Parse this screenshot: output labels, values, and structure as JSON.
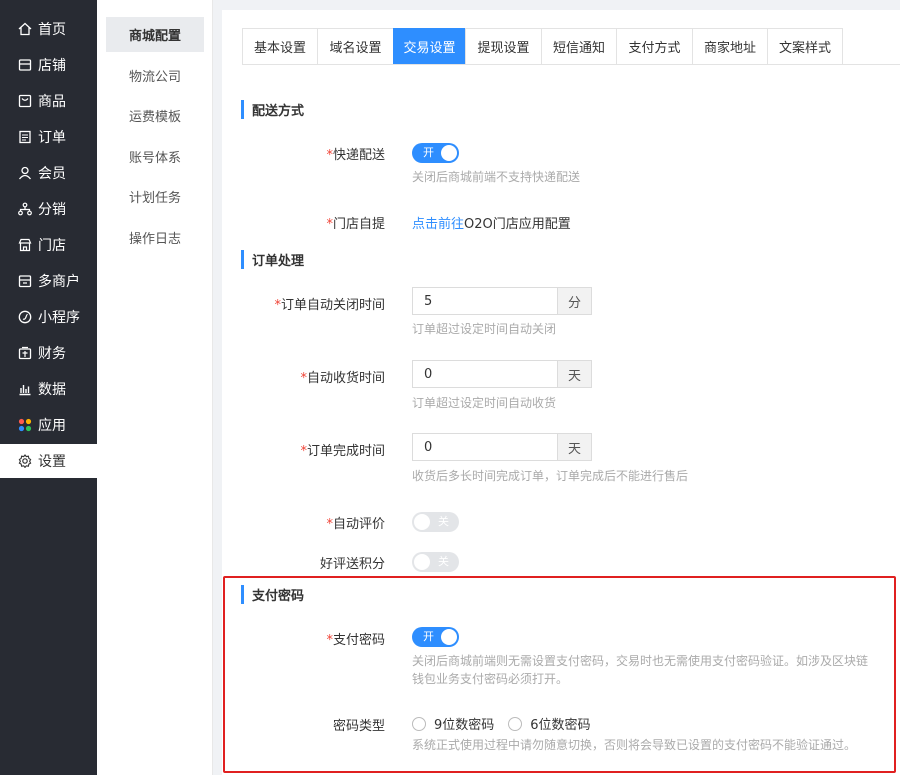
{
  "sidebar": {
    "items": [
      {
        "label": "首页",
        "icon": "home-icon"
      },
      {
        "label": "店铺",
        "icon": "store-icon"
      },
      {
        "label": "商品",
        "icon": "goods-icon"
      },
      {
        "label": "订单",
        "icon": "order-icon"
      },
      {
        "label": "会员",
        "icon": "member-icon"
      },
      {
        "label": "分销",
        "icon": "distribution-icon"
      },
      {
        "label": "门店",
        "icon": "shop-icon"
      },
      {
        "label": "多商户",
        "icon": "multi-merchant-icon"
      },
      {
        "label": "小程序",
        "icon": "mini-program-icon"
      },
      {
        "label": "财务",
        "icon": "finance-icon"
      },
      {
        "label": "数据",
        "icon": "data-icon"
      },
      {
        "label": "应用",
        "icon": "apps-icon"
      },
      {
        "label": "设置",
        "icon": "gear-icon"
      }
    ],
    "active_index": 12
  },
  "subsidebar": {
    "items": [
      "商城配置",
      "物流公司",
      "运费模板",
      "账号体系",
      "计划任务",
      "操作日志"
    ],
    "active_index": 0
  },
  "tabs": {
    "items": [
      "基本设置",
      "域名设置",
      "交易设置",
      "提现设置",
      "短信通知",
      "支付方式",
      "商家地址",
      "文案样式"
    ],
    "active_index": 2
  },
  "delivery": {
    "title": "配送方式",
    "express_label": "快递配送",
    "express_switch": "开",
    "express_help": "关闭后商城前端不支持快递配送",
    "pickup_label": "门店自提",
    "pickup_link": "点击前往",
    "pickup_text": "O2O门店应用配置"
  },
  "order": {
    "title": "订单处理",
    "close_label": "订单自动关闭时间",
    "close_value": "5",
    "close_unit": "分",
    "close_help": "订单超过设定时间自动关闭",
    "receive_label": "自动收货时间",
    "receive_value": "0",
    "receive_unit": "天",
    "receive_help": "订单超过设定时间自动收货",
    "complete_label": "订单完成时间",
    "complete_value": "0",
    "complete_unit": "天",
    "complete_help": "收货后多长时间完成订单，订单完成后不能进行售后",
    "review_label": "自动评价",
    "review_switch": "关",
    "points_label": "好评送积分",
    "points_switch": "关"
  },
  "payment": {
    "title": "支付密码",
    "pwd_label": "支付密码",
    "pwd_switch": "开",
    "pwd_help_1": "关闭后商城前端则无需设置支付密码，交易时也无需使用支付密码验证。如涉及区块链",
    "pwd_help_2": "钱包业务支付密码必须打开。",
    "type_label": "密码类型",
    "type_opt_9": "9位数密码",
    "type_opt_6": "6位数密码",
    "type_help": "系统正式使用过程中请勿随意切换，否则将会导致已设置的支付密码不能验证通过。"
  },
  "colors": {
    "accent": "#2e8eff",
    "sidebar_bg": "#282b33",
    "highlight": "#e02020"
  }
}
